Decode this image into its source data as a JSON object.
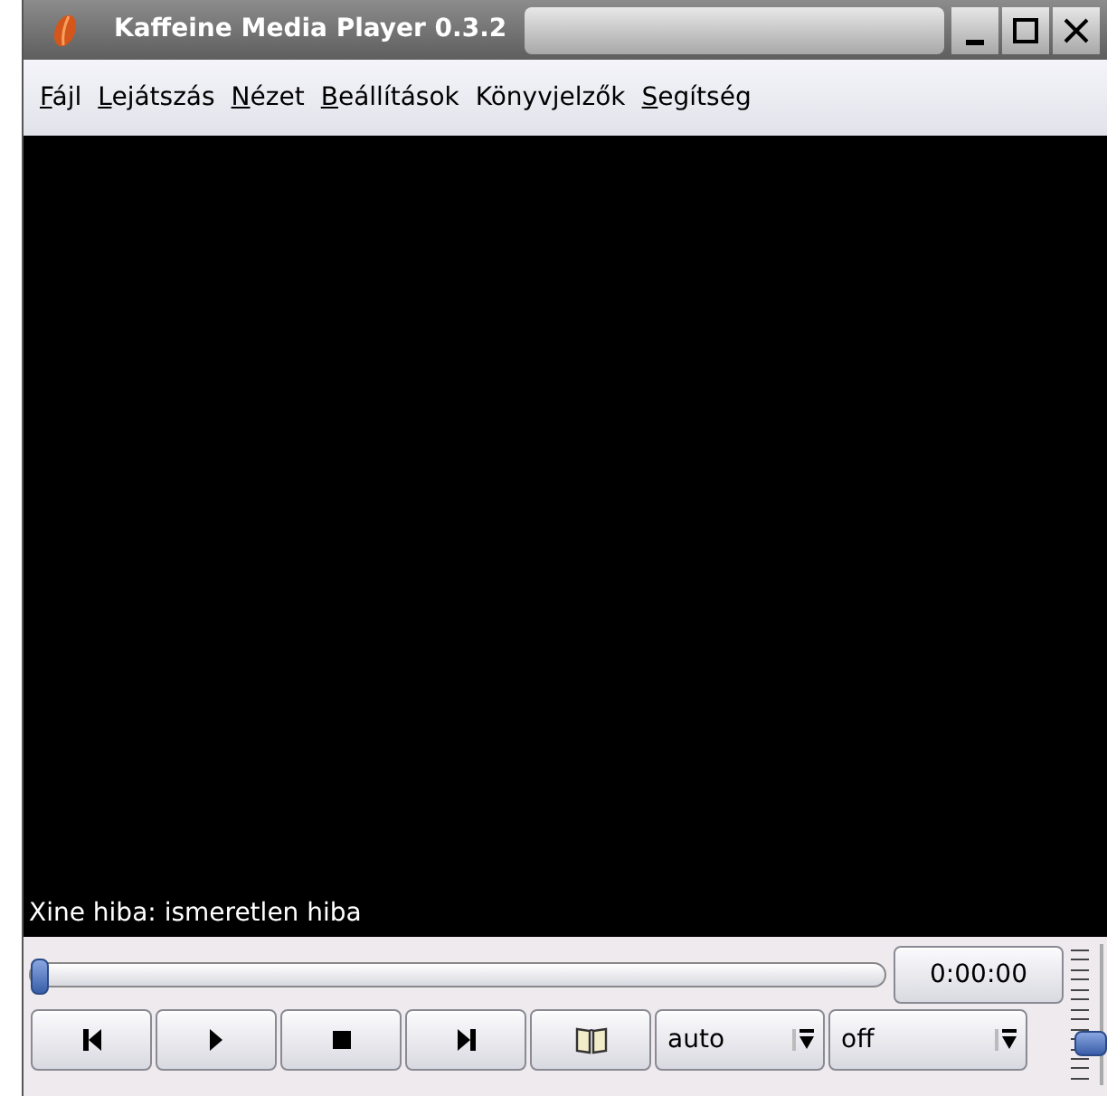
{
  "window": {
    "title": "Kaffeine Media Player 0.3.2"
  },
  "menu": [
    {
      "label": "Fájl",
      "underlined_first": true
    },
    {
      "label": "Lejátszás",
      "underlined_first": true
    },
    {
      "label": "Nézet",
      "underlined_first": true
    },
    {
      "label": "Beállítások",
      "underlined_first": true
    },
    {
      "label": "Könyvjelzők",
      "underlined_first": false
    },
    {
      "label": "Segítség",
      "underlined_first": true
    }
  ],
  "video": {
    "message": "Xine hiba: ismeretlen hiba"
  },
  "seek": {
    "level": 0
  },
  "time": "0:00:00",
  "volume": {
    "level": 0.25
  },
  "controls": [
    {
      "kind": "previous"
    },
    {
      "kind": "play"
    },
    {
      "kind": "stop"
    },
    {
      "kind": "next"
    },
    {
      "kind": "bookmarks"
    }
  ],
  "combos": [
    {
      "value": "auto"
    },
    {
      "value": "off"
    }
  ]
}
